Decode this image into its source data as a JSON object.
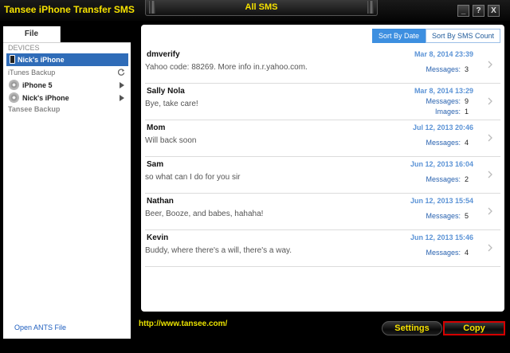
{
  "app": {
    "title": "Tansee iPhone Transfer SMS",
    "center_title": "All SMS"
  },
  "window_buttons": {
    "minimize": "_",
    "help": "?",
    "close": "X"
  },
  "left_panel": {
    "tab_label": "File",
    "devices_label": "DEVICES",
    "selected_device": "Nick's iPhone",
    "itunes_backup_label": "iTunes Backup",
    "backups": [
      {
        "label": "iPhone 5"
      },
      {
        "label": "Nick's iPhone"
      }
    ],
    "tansee_backup_label": "Tansee Backup",
    "open_ants_label": "Open ANTS File"
  },
  "sort": {
    "by_date": "Sort By Date",
    "by_count": "Sort By SMS Count",
    "active": "by_date"
  },
  "messages": [
    {
      "name": "dmverify",
      "preview": "Yahoo code: 88269. More info in.r.yahoo.com.",
      "date": "Mar 8, 2014 23:39",
      "messages_label": "Messages:",
      "messages": "3"
    },
    {
      "name": "Sally Nola",
      "preview": "Bye, take care!",
      "date": "Mar 8, 2014 13:29",
      "messages_label": "Messages:",
      "messages": "9",
      "images_label": "Images:",
      "images": "1"
    },
    {
      "name": "Mom",
      "preview": "Will back soon",
      "date": "Jul 12, 2013 20:46",
      "messages_label": "Messages:",
      "messages": "4"
    },
    {
      "name": "Sam",
      "preview": "so what can I do for you sir",
      "date": "Jun 12, 2013 16:04",
      "messages_label": "Messages:",
      "messages": "2"
    },
    {
      "name": "Nathan",
      "preview": "Beer, Booze, and babes, hahaha!",
      "date": "Jun 12, 2013 15:54",
      "messages_label": "Messages:",
      "messages": "5"
    },
    {
      "name": "Kevin",
      "preview": "Buddy, where there's a will, there's a way.",
      "date": "Jun 12, 2013 15:46",
      "messages_label": "Messages:",
      "messages": "4"
    }
  ],
  "footer": {
    "url": "http://www.tansee.com/",
    "settings_label": "Settings",
    "copy_label": "Copy"
  },
  "colors": {
    "accent_yellow": "#f6e200",
    "selection_blue": "#2f6cb8",
    "date_blue": "#5b93d6",
    "copy_highlight": "#d40000"
  }
}
